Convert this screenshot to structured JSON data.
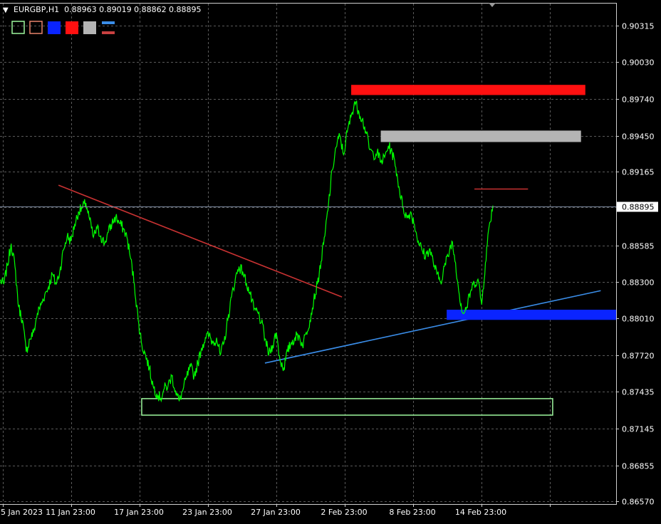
{
  "header": {
    "dropdown_glyph": "▼",
    "symbol_line": "EURGBP,H1  0.88963 0.89019 0.88862 0.88895"
  },
  "toolbar": {
    "icons": [
      {
        "name": "rectangle-outline-green-icon",
        "color": "#9ef79e"
      },
      {
        "name": "rectangle-outline-salmon-icon",
        "color": "#e8826a"
      },
      {
        "name": "blue-fill-icon",
        "color": "#0a24ff"
      },
      {
        "name": "red-fill-icon",
        "color": "#ff1010"
      },
      {
        "name": "gray-fill-icon",
        "color": "#b4b4b4"
      },
      {
        "name": "trendline-icon",
        "colors": [
          "#3a8de8",
          "#c84040"
        ]
      }
    ]
  },
  "chart_data": {
    "type": "line",
    "symbol": "EURGBP",
    "timeframe": "H1",
    "ohlc_readout": {
      "open": 0.88963,
      "high": 0.89019,
      "low": 0.88862,
      "close": 0.88895
    },
    "current_price_label": "0.88895",
    "y_ticks": [
      "0.90315",
      "0.90030",
      "0.89740",
      "0.89450",
      "0.89165",
      "0.88885",
      "0.88585",
      "0.88300",
      "0.88010",
      "0.87720",
      "0.87435",
      "0.87145",
      "0.86855",
      "0.86570"
    ],
    "ylim": [
      0.8655,
      0.9049
    ],
    "x_ticks": [
      "5 Jan 2023",
      "11 Jan 23:00",
      "17 Jan 23:00",
      "23 Jan 23:00",
      "27 Jan 23:00",
      "2 Feb 23:00",
      "8 Feb 23:00",
      "14 Feb 23:00"
    ],
    "series": [
      {
        "color": "#00ff00",
        "values": [
          0.8831,
          0.8828,
          0.8843,
          0.886,
          0.8842,
          0.881,
          0.88,
          0.8775,
          0.8785,
          0.879,
          0.8805,
          0.8812,
          0.882,
          0.8826,
          0.8836,
          0.8828,
          0.8838,
          0.8855,
          0.8866,
          0.8862,
          0.8875,
          0.8885,
          0.8888,
          0.8892,
          0.8879,
          0.8865,
          0.8872,
          0.8866,
          0.886,
          0.8869,
          0.8876,
          0.8881,
          0.8876,
          0.8872,
          0.8865,
          0.8848,
          0.8828,
          0.88,
          0.878,
          0.8772,
          0.8762,
          0.8748,
          0.8742,
          0.8738,
          0.8746,
          0.8748,
          0.8756,
          0.8744,
          0.8736,
          0.8745,
          0.8755,
          0.8763,
          0.8756,
          0.8766,
          0.8778,
          0.8786,
          0.8788,
          0.8782,
          0.8786,
          0.8772,
          0.8782,
          0.88,
          0.8818,
          0.8832,
          0.8842,
          0.8838,
          0.8829,
          0.882,
          0.8808,
          0.8806,
          0.8798,
          0.8785,
          0.8773,
          0.878,
          0.879,
          0.8768,
          0.8762,
          0.8775,
          0.8782,
          0.8786,
          0.8788,
          0.878,
          0.879,
          0.88,
          0.8815,
          0.8828,
          0.8846,
          0.8866,
          0.8892,
          0.8918,
          0.8936,
          0.8945,
          0.893,
          0.8948,
          0.896,
          0.8972,
          0.8965,
          0.8958,
          0.8948,
          0.8934,
          0.893,
          0.8932,
          0.8924,
          0.8928,
          0.8937,
          0.8932,
          0.892,
          0.8902,
          0.8888,
          0.888,
          0.8885,
          0.8875,
          0.8862,
          0.8855,
          0.885,
          0.8856,
          0.8846,
          0.8836,
          0.883,
          0.8842,
          0.885,
          0.8862,
          0.8845,
          0.882,
          0.8805,
          0.881,
          0.8822,
          0.8829,
          0.8832,
          0.8812,
          0.8845,
          0.8874,
          0.889
        ]
      }
    ],
    "annotations": [
      {
        "type": "trendline",
        "color": "#c83232",
        "x": [
          0.095,
          0.555
        ],
        "y": [
          0.8906,
          0.8818
        ]
      },
      {
        "type": "trendline",
        "color": "#3a8de8",
        "x": [
          0.43,
          0.975
        ],
        "y": [
          0.8766,
          0.8823
        ]
      },
      {
        "type": "zone",
        "color": "#ff1010",
        "x": [
          0.57,
          0.95
        ],
        "y": [
          0.8977,
          0.8985
        ]
      },
      {
        "type": "zone",
        "color": "#b4b4b4",
        "x": [
          0.618,
          0.943
        ],
        "y": [
          0.894,
          0.8949
        ]
      },
      {
        "type": "zone",
        "color": "#0a24ff",
        "x": [
          0.725,
          1.0
        ],
        "y": [
          0.88,
          0.8808
        ]
      },
      {
        "type": "zone-outline",
        "color": "#9ef79e",
        "x": [
          0.23,
          0.897
        ],
        "y": [
          0.8725,
          0.8738
        ]
      },
      {
        "type": "hline-segment",
        "color": "#c83232",
        "x": [
          0.77,
          0.857
        ],
        "y": [
          0.8903,
          0.8903
        ]
      }
    ],
    "grid": true
  }
}
